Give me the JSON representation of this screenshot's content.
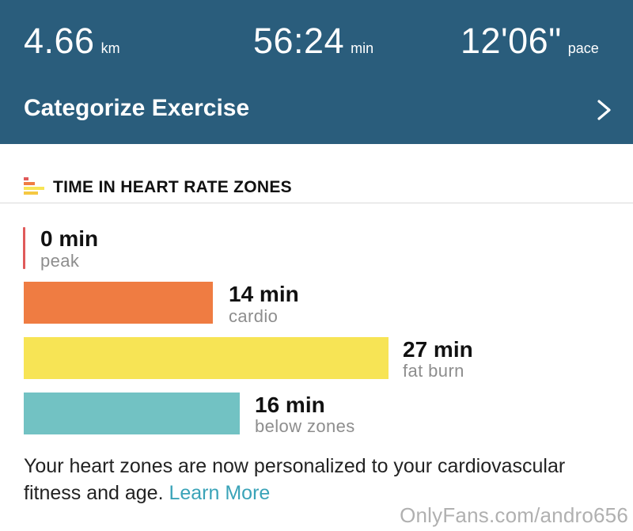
{
  "summary": {
    "distance": {
      "value": "4.66",
      "unit": "km"
    },
    "duration": {
      "value": "56:24",
      "unit": "min"
    },
    "pace": {
      "value": "12'06\"",
      "unit": "pace"
    }
  },
  "categorize": {
    "label": "Categorize Exercise",
    "icon": "chevron-right-icon"
  },
  "zones": {
    "title": "TIME IN HEART RATE ZONES",
    "icon": "heart-rate-zones-icon",
    "items": [
      {
        "value": "0 min",
        "name": "peak",
        "minutes": 0,
        "color": "#e05a5a"
      },
      {
        "value": "14 min",
        "name": "cardio",
        "minutes": 14,
        "color": "#ef7c42"
      },
      {
        "value": "27 min",
        "name": "fat burn",
        "minutes": 27,
        "color": "#f7e455"
      },
      {
        "value": "16 min",
        "name": "below zones",
        "minutes": 16,
        "color": "#72c2c3"
      }
    ]
  },
  "note": {
    "text": "Your heart zones are now personalized to your cardiovascular fitness and age.",
    "link": "Learn More",
    "link_color": "#3aa3b8"
  },
  "watermark": "OnlyFans.com/andro656",
  "colors": {
    "header_bg": "#2a5d7c"
  }
}
